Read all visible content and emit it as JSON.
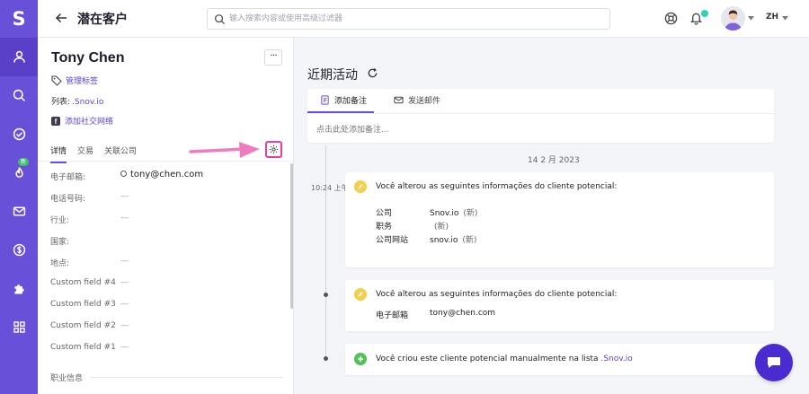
{
  "rail": {
    "logo": "S",
    "new_badge": "新"
  },
  "topbar": {
    "title": "潜在客户",
    "search_placeholder": "输入搜索内容或使用高级过滤器",
    "language": "ZH"
  },
  "contact": {
    "name": "Tony Chen",
    "manage_tags": "管理标签",
    "list_label": "列表:",
    "list_value": ".Snov.io",
    "add_social": "添加社交网络"
  },
  "tabs": [
    {
      "label": "详情"
    },
    {
      "label": "交易"
    },
    {
      "label": "关联公司"
    }
  ],
  "fields": [
    {
      "label": "电子邮箱:",
      "value": "tony@chen.com"
    },
    {
      "label": "电话号码:",
      "value": "—"
    },
    {
      "label": "行业:",
      "value": "—"
    },
    {
      "label": "国家:",
      "value": ""
    },
    {
      "label": "地点:",
      "value": "—"
    },
    {
      "label": "Custom field #4",
      "value": "—"
    },
    {
      "label": "Custom field #3",
      "value": "—"
    },
    {
      "label": "Custom field #2",
      "value": "—"
    },
    {
      "label": "Custom field #1",
      "value": "—"
    }
  ],
  "section_title": "职业信息",
  "main": {
    "title": "近期活动",
    "note_tab": "添加备注",
    "email_tab": "发送邮件",
    "note_placeholder": "点击此处添加备注...",
    "date": "14 2 月 2023",
    "time": "10:24 上午"
  },
  "events": [
    {
      "text": "Você alterou as seguintes informações do cliente potencial:",
      "changes": [
        {
          "key": "公司",
          "value": "Snov.io",
          "new": "(新)"
        },
        {
          "key": "职务",
          "value": "",
          "new": "(新)"
        },
        {
          "key": "公司网站",
          "value": "snov.io",
          "new": "(新)"
        }
      ]
    },
    {
      "text": "Você alterou as seguintes informações do cliente potencial:",
      "changes": [
        {
          "key": "电子邮箱",
          "value": "tony@chen.com",
          "new": ""
        }
      ]
    },
    {
      "text": "Você criou este cliente potencial manualmente na lista",
      "link": ".Snov.io"
    }
  ],
  "colors": {
    "rail": "#6950d8",
    "accent": "#6b4fdc",
    "highlight": "#e8409a",
    "link": "#5b44d6"
  }
}
